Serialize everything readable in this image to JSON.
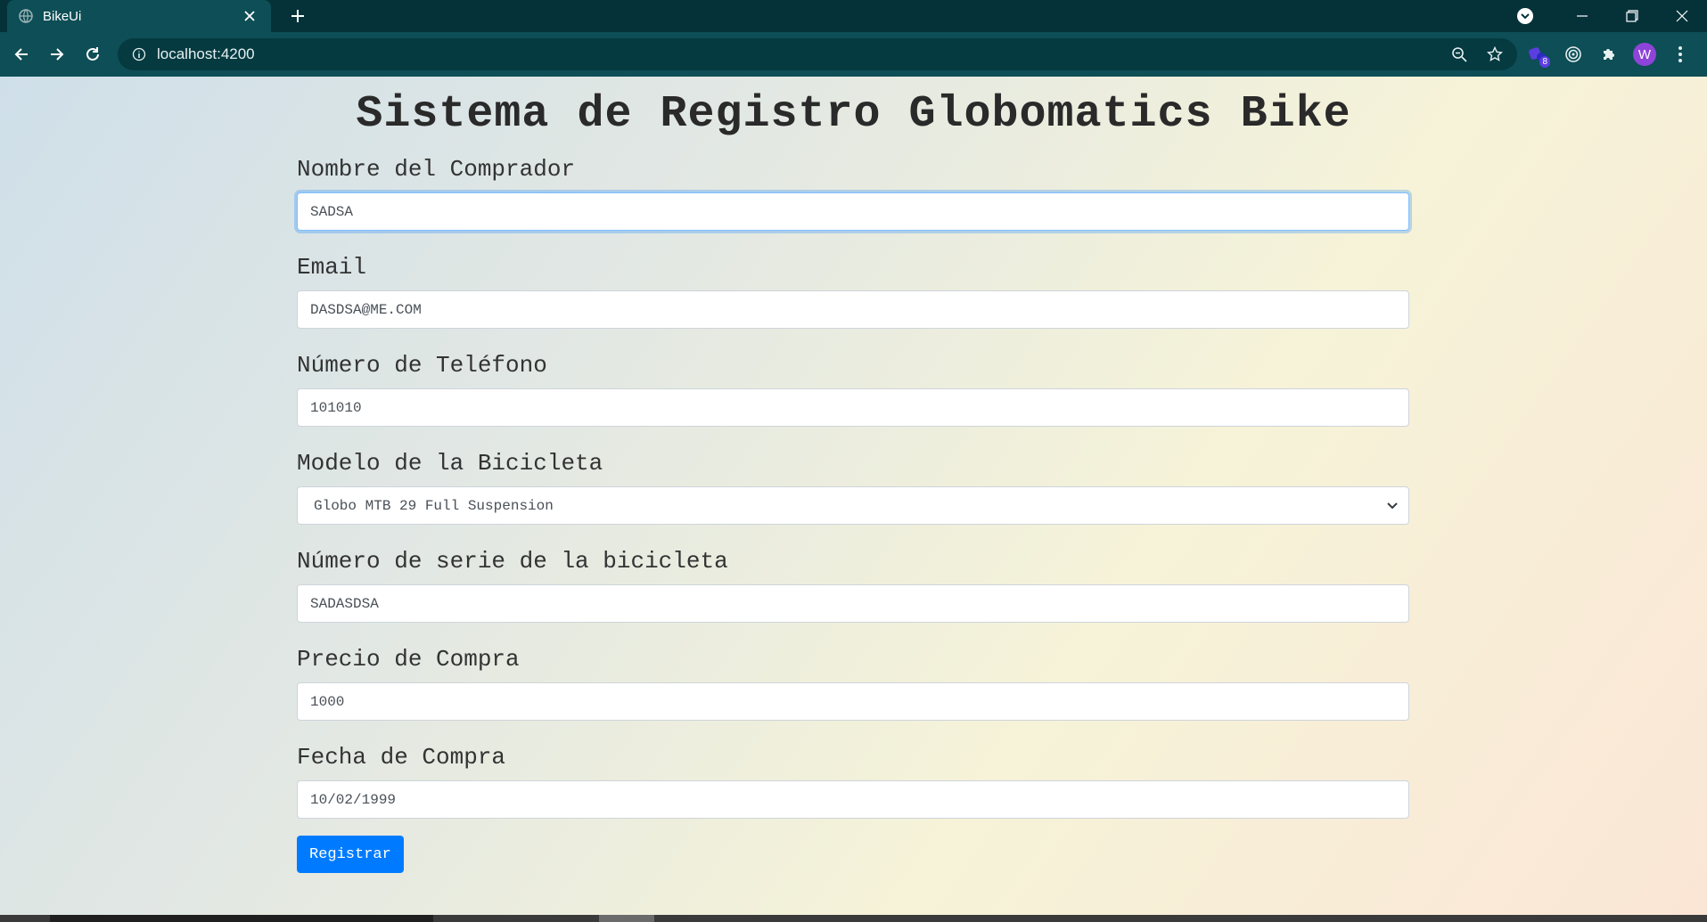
{
  "browser": {
    "tab_title": "BikeUi",
    "url": "localhost:4200",
    "extension_badge": "8",
    "avatar_letter": "W"
  },
  "page": {
    "title": "Sistema de Registro Globomatics Bike"
  },
  "form": {
    "fields": [
      {
        "label": "Nombre del Comprador",
        "value": "SADSA"
      },
      {
        "label": "Email",
        "value": "DASDSA@ME.COM"
      },
      {
        "label": "Número de Teléfono",
        "value": "101010"
      },
      {
        "label": "Modelo de la Bicicleta",
        "value": "Globo MTB 29 Full Suspension"
      },
      {
        "label": "Número de serie de la bicicleta",
        "value": "SADASDSA"
      },
      {
        "label": "Precio de Compra",
        "value": "1000"
      },
      {
        "label": "Fecha de Compra",
        "value": "10/02/1999"
      }
    ],
    "submit_label": "Registrar"
  },
  "colors": {
    "primary_button": "#007bff",
    "focus_ring": "#80bdff"
  }
}
